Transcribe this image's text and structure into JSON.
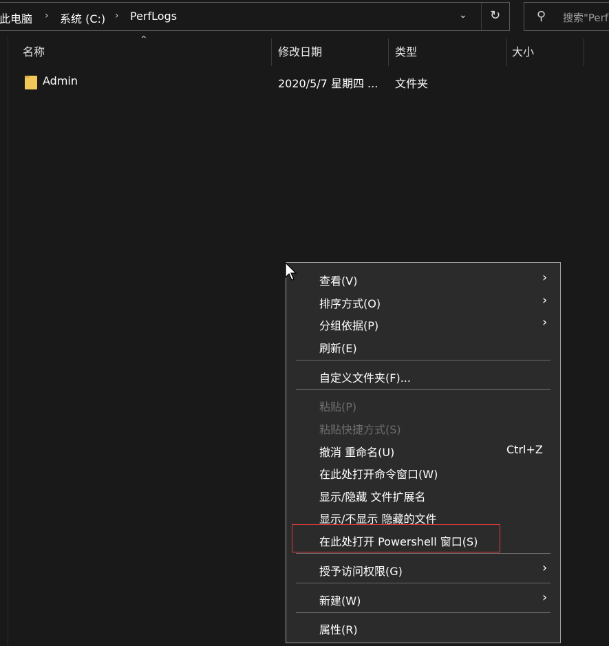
{
  "address_bar": {
    "breadcrumbs": [
      "此电脑",
      "系统 (C:)",
      "PerfLogs"
    ],
    "dropdown_icon": "chevron-down-icon",
    "refresh_icon": "refresh-icon"
  },
  "search": {
    "placeholder": "搜索\"Perf"
  },
  "columns": {
    "name": "名称",
    "modified": "修改日期",
    "type": "类型",
    "size": "大小"
  },
  "files": [
    {
      "name": "Admin",
      "modified": "2020/5/7 星期四 ...",
      "type": "文件夹",
      "size": ""
    }
  ],
  "context_menu": {
    "view": "查看(V)",
    "sort_by": "排序方式(O)",
    "group_by": "分组依据(P)",
    "refresh": "刷新(E)",
    "customize_folder": "自定义文件夹(F)...",
    "paste": "粘贴(P)",
    "paste_shortcut": "粘贴快捷方式(S)",
    "undo_rename": "撤消 重命名(U)",
    "undo_shortcut": "Ctrl+Z",
    "open_cmd": "在此处打开命令窗口(W)",
    "toggle_extensions": "显示/隐藏 文件扩展名",
    "toggle_hidden": "显示/不显示 隐藏的文件",
    "open_powershell": "在此处打开 Powershell 窗口(S)",
    "give_access": "授予访问权限(G)",
    "new": "新建(W)",
    "properties": "属性(R)"
  },
  "colors": {
    "background": "#191919",
    "menu_background": "#2b2b2b",
    "folder": "#f2c75a",
    "highlight_border": "#e23b3b",
    "disabled_text": "#6d6d6d"
  }
}
